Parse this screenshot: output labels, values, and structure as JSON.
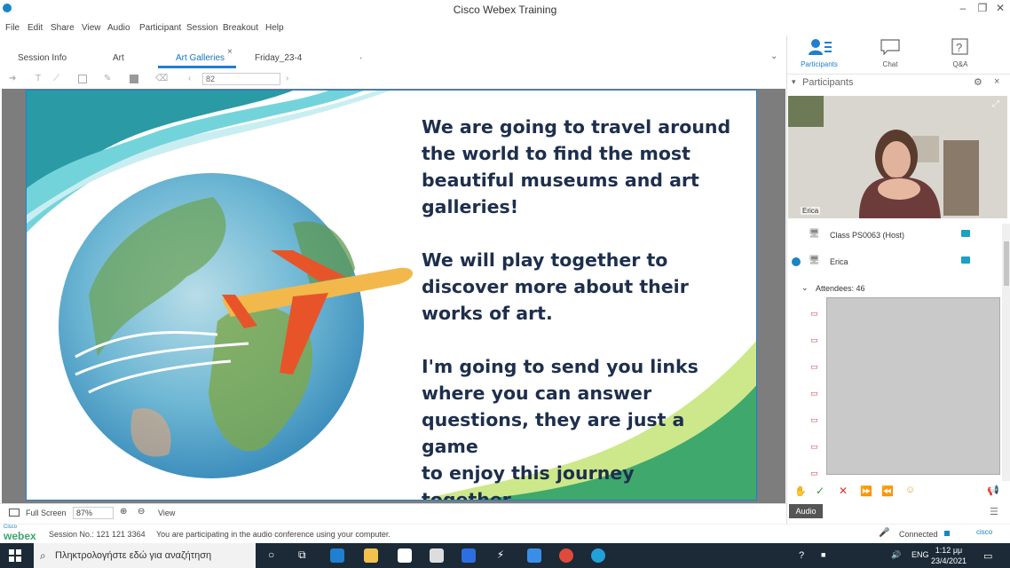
{
  "window": {
    "title": "Cisco Webex Training",
    "minimize": "–",
    "restore": "❐",
    "close": "✕"
  },
  "menu": [
    "File",
    "Edit",
    "Share",
    "View",
    "Audio",
    "Participant",
    "Session",
    "Breakout",
    "Help"
  ],
  "tabs": {
    "items": [
      "Session Info",
      "Art",
      "Art Galleries",
      "Friday_23-4"
    ],
    "active_index": 2,
    "close_glyph": "×",
    "more_glyph": "·"
  },
  "toolbar": {
    "page_value": "82"
  },
  "slide": {
    "paragraphs": [
      "We are going to travel around\nthe world to find the most\nbeautiful museums and art\ngalleries!",
      "We will play together to\ndiscover more about their\nworks of art.",
      "I'm going to send you links\nwhere you can answer\nquestions, they are just a game\nto enjoy this journey together."
    ]
  },
  "right_panel": {
    "tabs": [
      "Participants",
      "Chat",
      "Q&A"
    ],
    "header": "Participants",
    "video_name": "Erica",
    "participants": [
      {
        "name": "Class PS0063 (Host)"
      },
      {
        "name": "Erica"
      }
    ],
    "attendees_label": "Attendees: 46",
    "audio_tooltip": "Audio"
  },
  "status": {
    "full_screen": "Full Screen",
    "zoom": "87%",
    "view": "View"
  },
  "infobar": {
    "brand_small": "Cisco",
    "brand": "webex",
    "session": "Session No.: 121 121 3364",
    "audio_msg": "You are participating in the audio conference using your computer.",
    "connection": "Connected",
    "cisco": "cisco"
  },
  "taskbar": {
    "search_placeholder": "Πληκτρολογήστε εδώ για αναζήτηση",
    "time": "1:12 μμ",
    "date": "23/4/2021",
    "lang": "ENG"
  },
  "colors": {
    "accent": "#1f7fd1",
    "slide_text": "#1e2f4d",
    "teal": "#3fb8c0",
    "green": "#3aa56e"
  }
}
